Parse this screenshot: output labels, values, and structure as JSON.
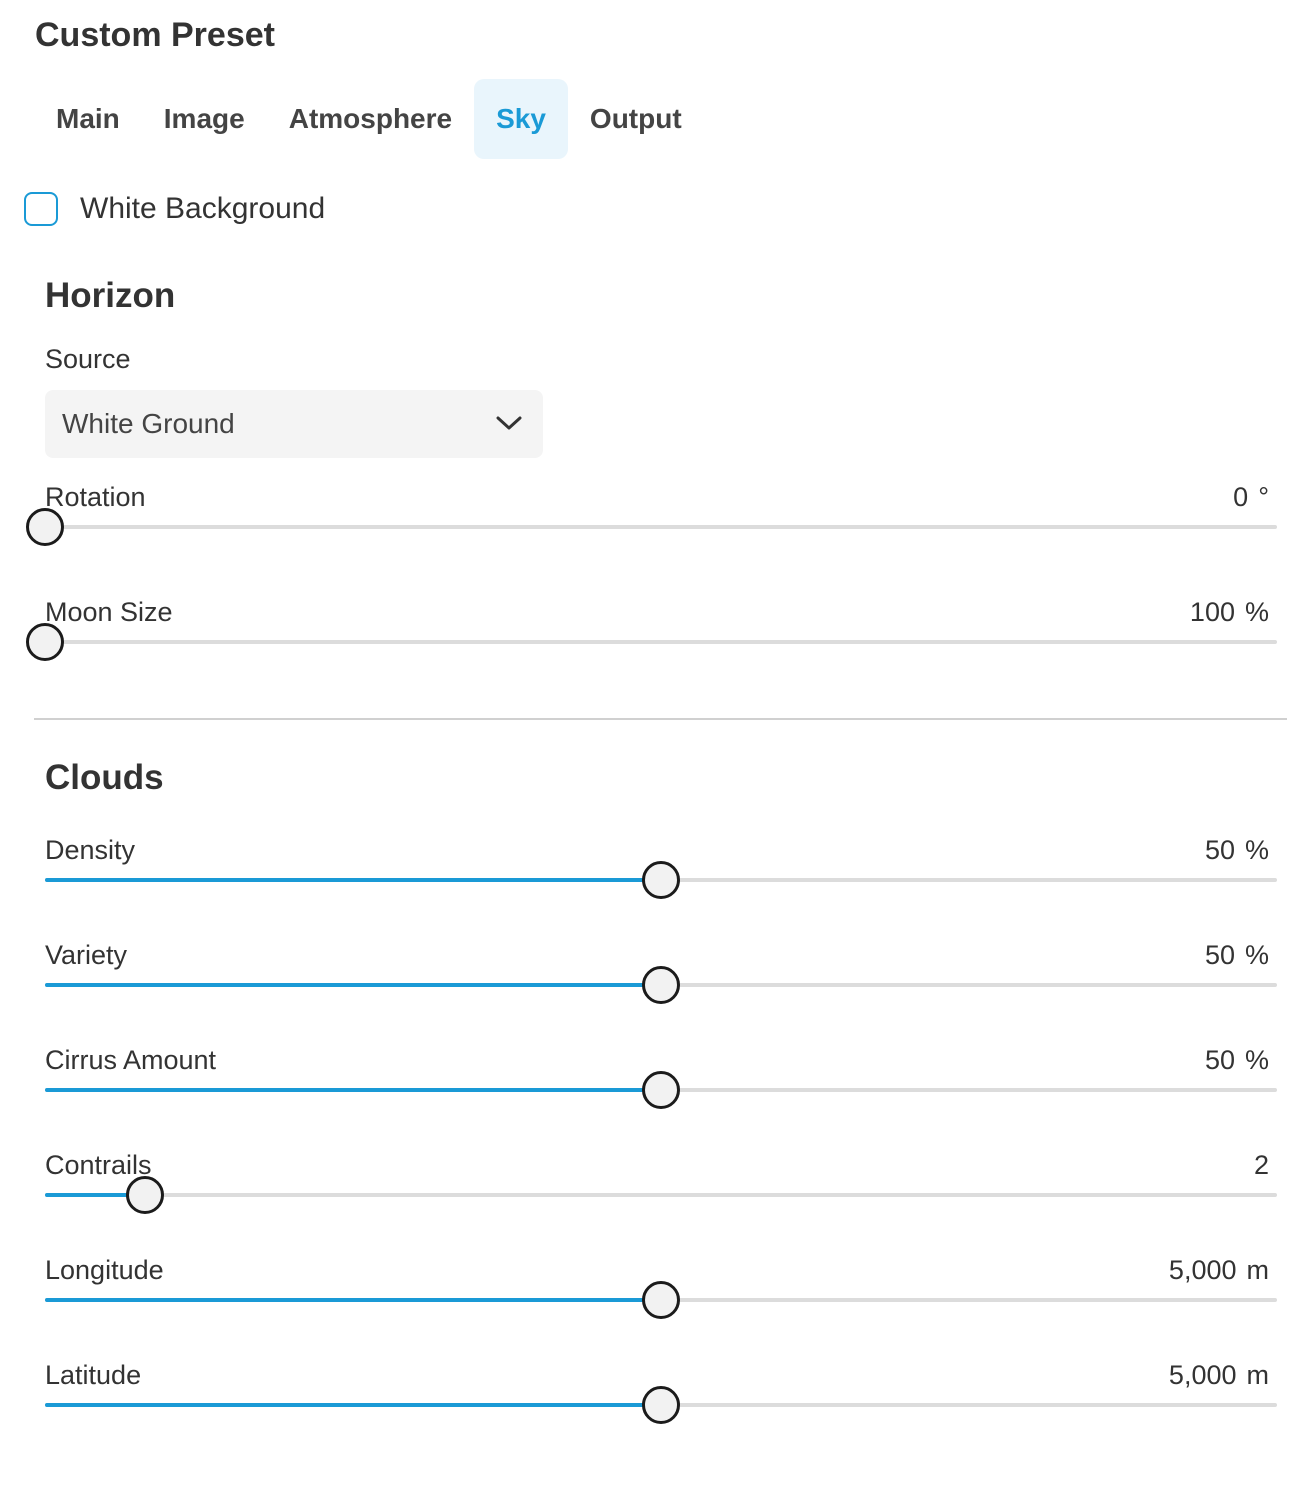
{
  "title": "Custom Preset",
  "tabs": [
    {
      "label": "Main",
      "active": false
    },
    {
      "label": "Image",
      "active": false
    },
    {
      "label": "Atmosphere",
      "active": false
    },
    {
      "label": "Sky",
      "active": true
    },
    {
      "label": "Output",
      "active": false
    }
  ],
  "white_background": {
    "label": "White Background",
    "checked": false
  },
  "horizon": {
    "title": "Horizon",
    "source": {
      "label": "Source",
      "value": "White Ground"
    },
    "rotation": {
      "label": "Rotation",
      "value": "0",
      "unit": "°",
      "fraction": 0
    },
    "moon_size": {
      "label": "Moon Size",
      "value": "100",
      "unit": "%",
      "fraction": 0
    }
  },
  "clouds": {
    "title": "Clouds",
    "density": {
      "label": "Density",
      "value": "50",
      "unit": "%",
      "fraction": 0.5
    },
    "variety": {
      "label": "Variety",
      "value": "50",
      "unit": "%",
      "fraction": 0.5
    },
    "cirrus_amount": {
      "label": "Cirrus Amount",
      "value": "50",
      "unit": "%",
      "fraction": 0.5
    },
    "contrails": {
      "label": "Contrails",
      "value": "2",
      "unit": "",
      "fraction": 0.081
    },
    "longitude": {
      "label": "Longitude",
      "value": "5,000",
      "unit": "m",
      "fraction": 0.5
    },
    "latitude": {
      "label": "Latitude",
      "value": "5,000",
      "unit": "m",
      "fraction": 0.5
    }
  },
  "colors": {
    "accent": "#1a9ad6",
    "active_tab_bg": "#e9f5fc",
    "track": "#dcdcdc",
    "thumb_border": "#1b1b1b"
  }
}
